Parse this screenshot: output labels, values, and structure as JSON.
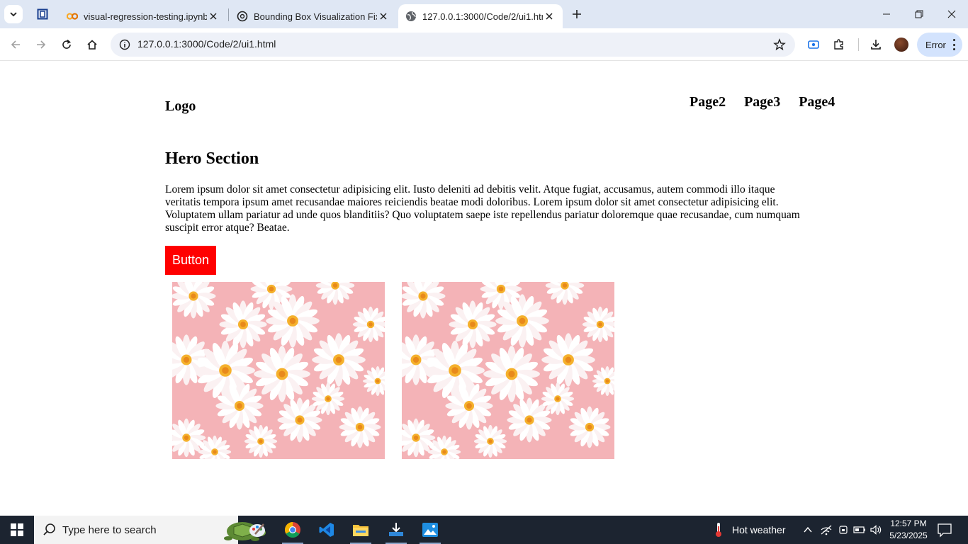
{
  "browser": {
    "tabs": [
      {
        "title": "visual-regression-testing.ipynb",
        "active": false
      },
      {
        "title": "Bounding Box Visualization Fix",
        "active": false
      },
      {
        "title": "127.0.0.1:3000/Code/2/ui1.html",
        "active": true
      }
    ],
    "url": "127.0.0.1:3000/Code/2/ui1.html",
    "profile_chip": "Error"
  },
  "page": {
    "logo": "Logo",
    "nav": [
      "Page2",
      "Page3",
      "Page4"
    ],
    "hero_title": "Hero Section",
    "hero_text": "Lorem ipsum dolor sit amet consectetur adipisicing elit. Iusto deleniti ad debitis velit. Atque fugiat, accusamus, autem commodi illo itaque veritatis tempora ipsum amet recusandae maiores reiciendis beatae modi doloribus. Lorem ipsum dolor sit amet consectetur adipisicing elit. Voluptatem ullam pariatur ad unde quos blanditiis? Quo voluptatem saepe iste repellendus pariatur doloremque quae recusandae, cum numquam suscipit error atque? Beatae.",
    "button_label": "Button",
    "button_color": "#ff0000"
  },
  "taskbar": {
    "search_placeholder": "Type here to search",
    "weather": "Hot weather",
    "time": "12:57 PM",
    "date": "5/23/2025"
  }
}
